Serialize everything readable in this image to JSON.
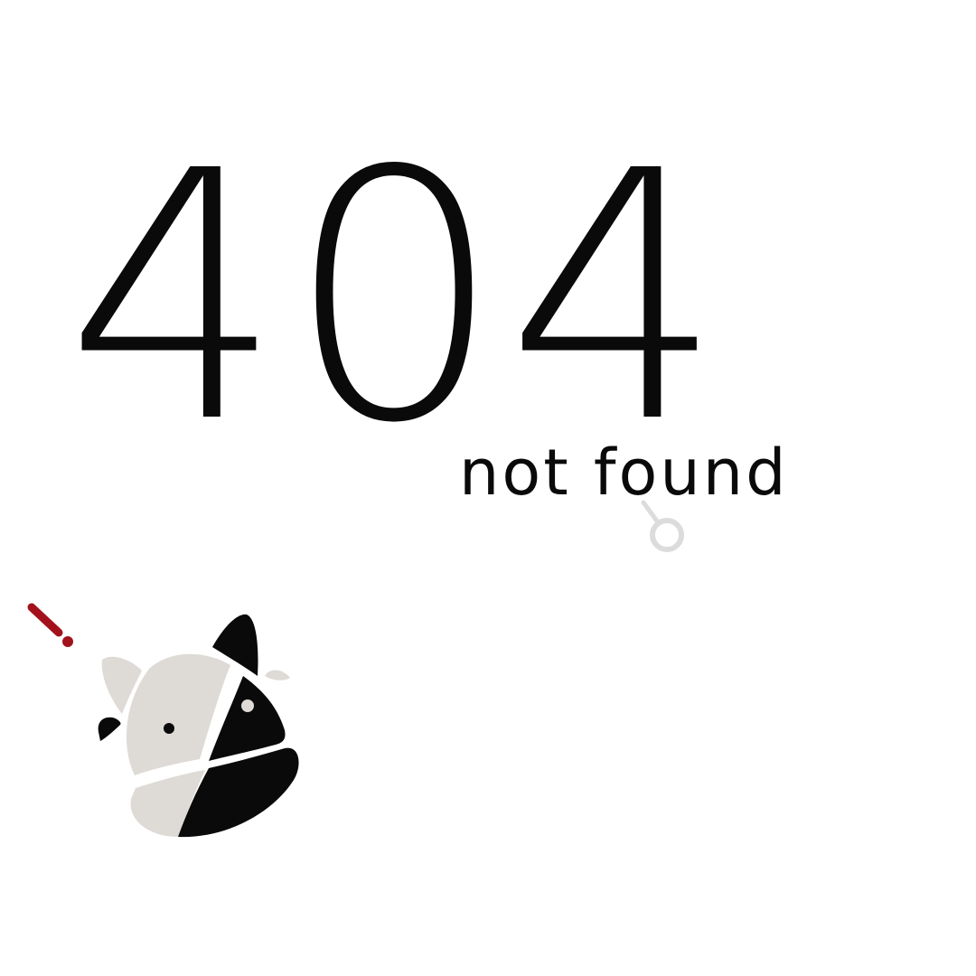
{
  "error": {
    "code": "404",
    "message": "not found"
  },
  "mascot": {
    "icon": "cow-head-icon",
    "alert_icon": "exclamation-icon",
    "lens_icon": "magnifier-icon"
  },
  "colors": {
    "background": "#ffffff",
    "text": "#0a0a0a",
    "mascot_light": "#dedbd6",
    "mascot_dark": "#0a0a0a",
    "alert": "#a3121c",
    "lens": "#dcdcdc"
  }
}
